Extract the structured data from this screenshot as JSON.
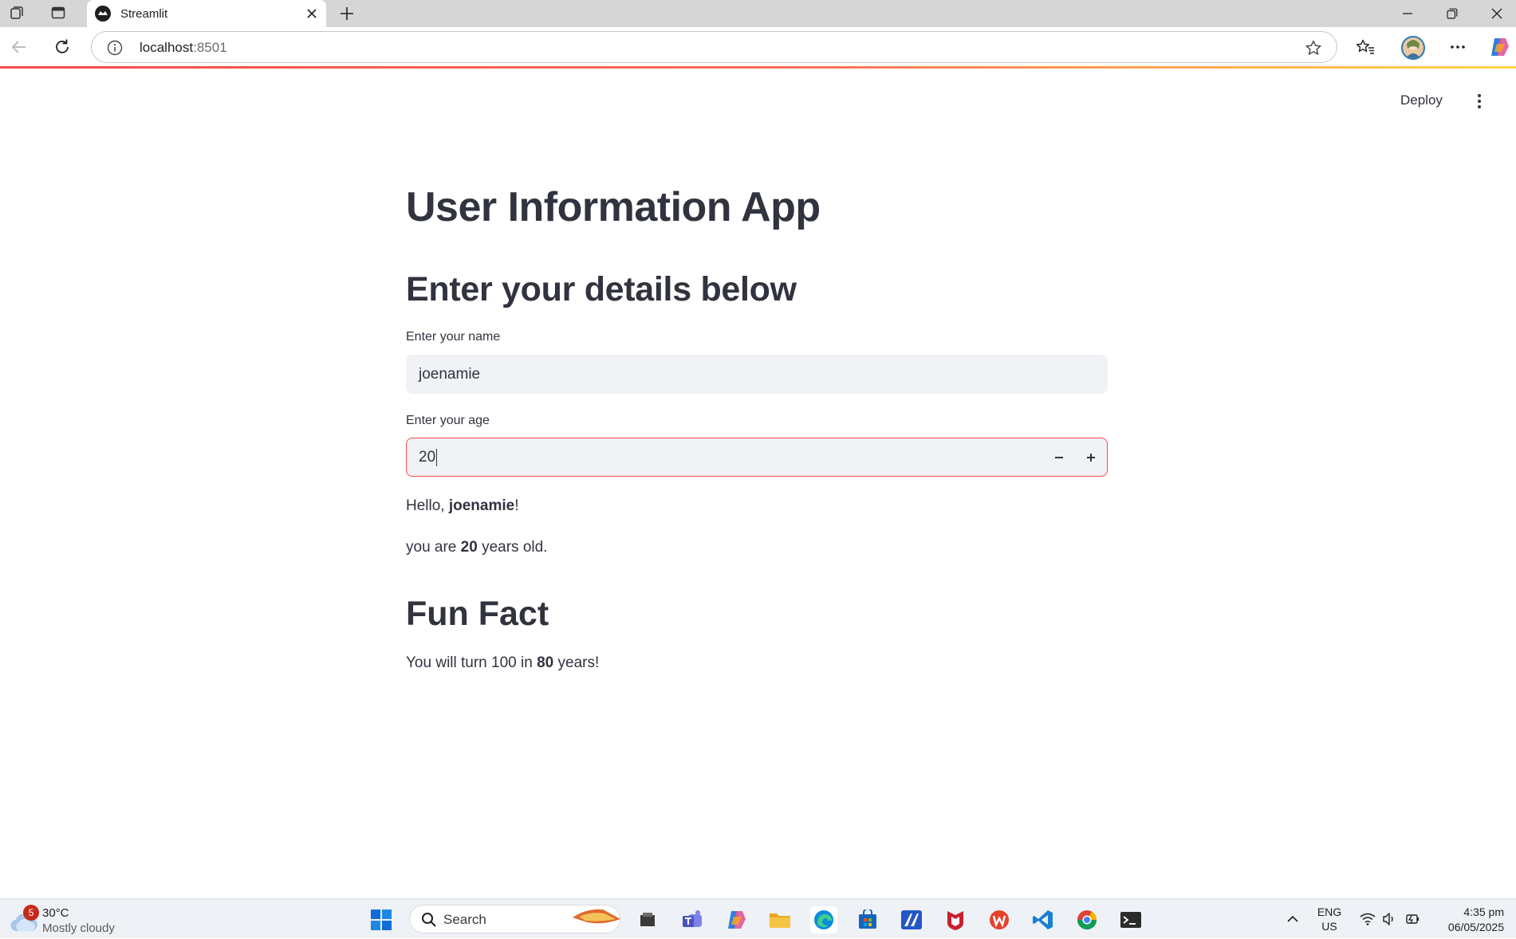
{
  "browser": {
    "tab_title": "Streamlit",
    "url_host": "localhost",
    "url_port": ":8501"
  },
  "app": {
    "deploy_label": "Deploy",
    "title": "User Information App",
    "subheader": "Enter your details below",
    "name_field": {
      "label": "Enter your name",
      "value": "joenamie"
    },
    "age_field": {
      "label": "Enter your age",
      "value": "20"
    },
    "greeting": {
      "prefix": "Hello, ",
      "name": "joenamie",
      "suffix": "!"
    },
    "age_line": {
      "prefix": "you are ",
      "age": "20",
      "suffix": " years old."
    },
    "fun_fact": {
      "heading": "Fun Fact",
      "prefix": "You will turn 100 in ",
      "years": "80",
      "suffix": " years!"
    }
  },
  "taskbar": {
    "weather_badge": "5",
    "weather_temp": "30°C",
    "weather_desc": "Mostly cloudy",
    "search_label": "Search",
    "lang_line1": "ENG",
    "lang_line2": "US",
    "time": "4:35 pm",
    "date": "06/05/2025",
    "apps": [
      "file-explorer-icon",
      "teams-icon",
      "copilot-icon",
      "folder-icon",
      "edge-icon",
      "store-icon",
      "app-icon",
      "mcafee-icon",
      "wps-icon",
      "vscode-icon",
      "chrome-icon",
      "terminal-icon"
    ]
  },
  "colors": {
    "streamlit_red": "#ff4b4b",
    "text": "#31333f",
    "input_bg": "#f0f2f6"
  }
}
